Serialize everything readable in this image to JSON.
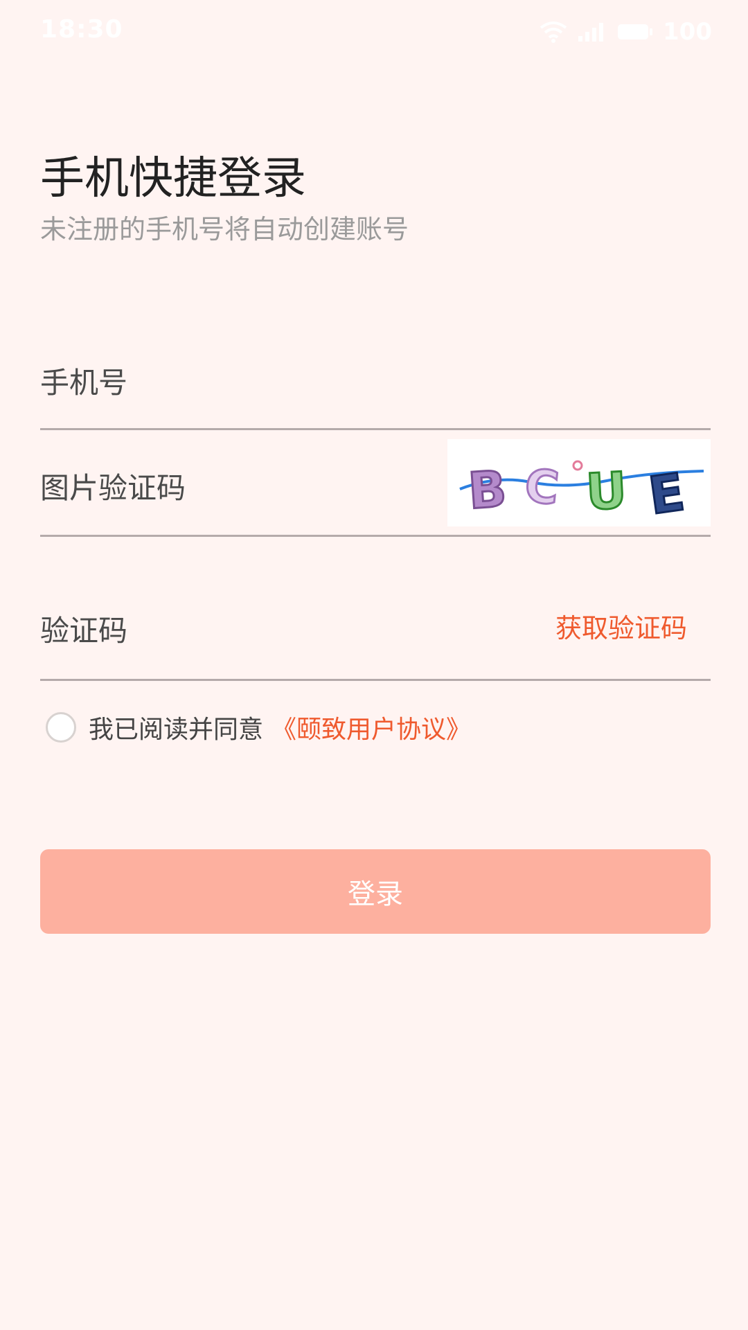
{
  "status_bar": {
    "time": "18:30",
    "battery": "100",
    "icons": [
      "wifi-icon",
      "signal-icon",
      "battery-icon"
    ]
  },
  "header": {
    "title": "手机快捷登录",
    "subtitle": "未注册的手机号将自动创建账号"
  },
  "form": {
    "phone_placeholder": "手机号",
    "captcha_placeholder": "图片验证码",
    "captcha_text": "BCUE",
    "sms_placeholder": "验证码",
    "get_code_label": "获取验证码"
  },
  "agreement": {
    "text": "我已阅读并同意",
    "link": "《颐致用户协议》",
    "checked": false
  },
  "login_button": "登录",
  "colors": {
    "background": "#fff4f2",
    "accent": "#ef5a2e",
    "button": "#fdb09f"
  }
}
